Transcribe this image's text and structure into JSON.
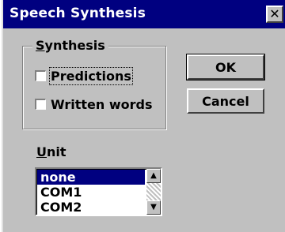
{
  "window": {
    "title": "Speech Synthesis",
    "close_glyph": "✕"
  },
  "synthesis_group": {
    "legend_underlined": "S",
    "legend_rest": "ynthesis",
    "options": [
      {
        "label": "Predictions",
        "checked": false,
        "focused": true
      },
      {
        "label": "Written words",
        "checked": false,
        "focused": false
      }
    ]
  },
  "buttons": {
    "ok_label": "OK",
    "cancel_label": "Cancel"
  },
  "unit": {
    "label_underlined": "U",
    "label_rest": "nit",
    "items": [
      "none",
      "COM1",
      "COM2"
    ],
    "selected": "none"
  },
  "icons": {
    "scroll_up": "▲",
    "scroll_down": "▼"
  },
  "colors": {
    "title_bar": "#000080",
    "dialog_face": "#c0c0c0",
    "selection": "#000080"
  }
}
